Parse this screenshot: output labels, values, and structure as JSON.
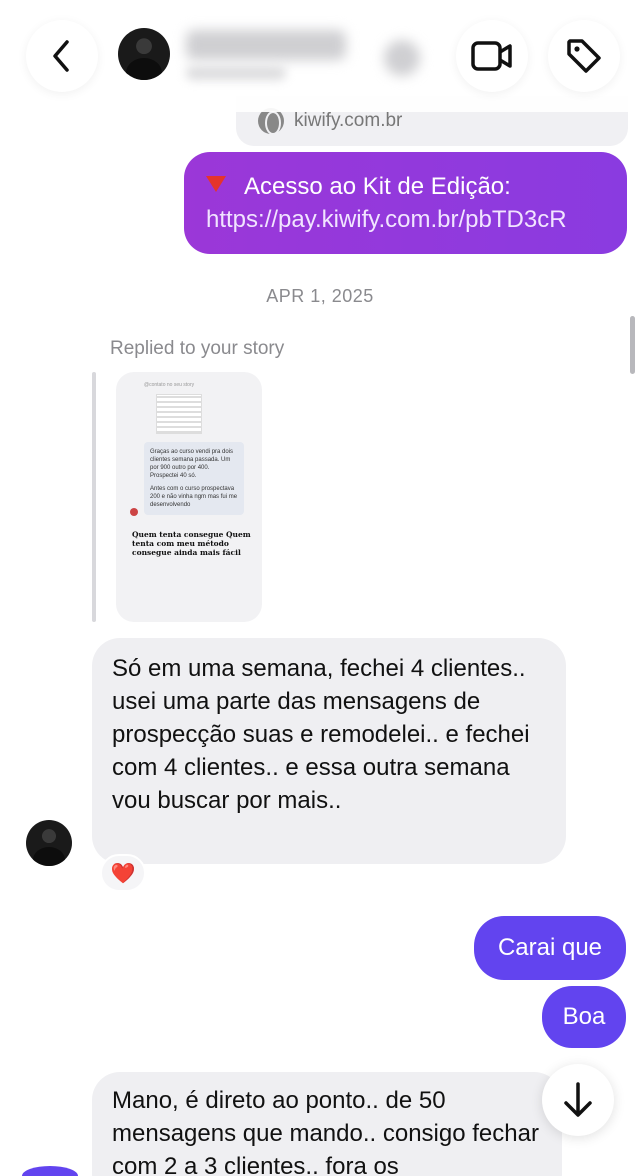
{
  "header": {
    "contact_name": "",
    "back_icon": "chevron-left-icon",
    "video_icon": "video-camera-icon",
    "tag_icon": "tag-icon"
  },
  "link_preview": {
    "domain": "kiwify.com.br"
  },
  "messages": {
    "purple_sent": {
      "line1": "Acesso ao Kit de Edição:",
      "line2": "https://pay.kiwify.com.br/pbTD3cR"
    },
    "date_divider": "APR 1, 2025",
    "reply_label": "Replied to your story",
    "story": {
      "top_text": "@contato no seu story",
      "card_p1": "Graças ao curso vendi pra dois clientes semana passada. Um por 900 outro por 400. Prospectei 40 só.",
      "card_p2": "Antes com o curso prospectava 200 e não vinha ngm mas fui me desenvolvendo",
      "caption": "Quem tenta consegue Quem tenta com meu método consegue ainda mais fácil"
    },
    "received_long": "Só em uma semana, fechei 4 clientes.. usei uma parte das mensagens de prospecção suas e remodelei.. e fechei com 4 clientes.. e essa outra semana vou buscar por mais..",
    "reaction": "❤️",
    "sent_1": "Carai que",
    "sent_2": "Boa",
    "received_last": "Mano, é direto ao ponto.. de 50 mensagens que mando.. consigo fechar com 2 a 3 clientes.. fora os"
  },
  "colors": {
    "purple_bubble": "#9b37d8",
    "sent_bubble": "#6244ef",
    "received_bubble": "#efeff2"
  }
}
